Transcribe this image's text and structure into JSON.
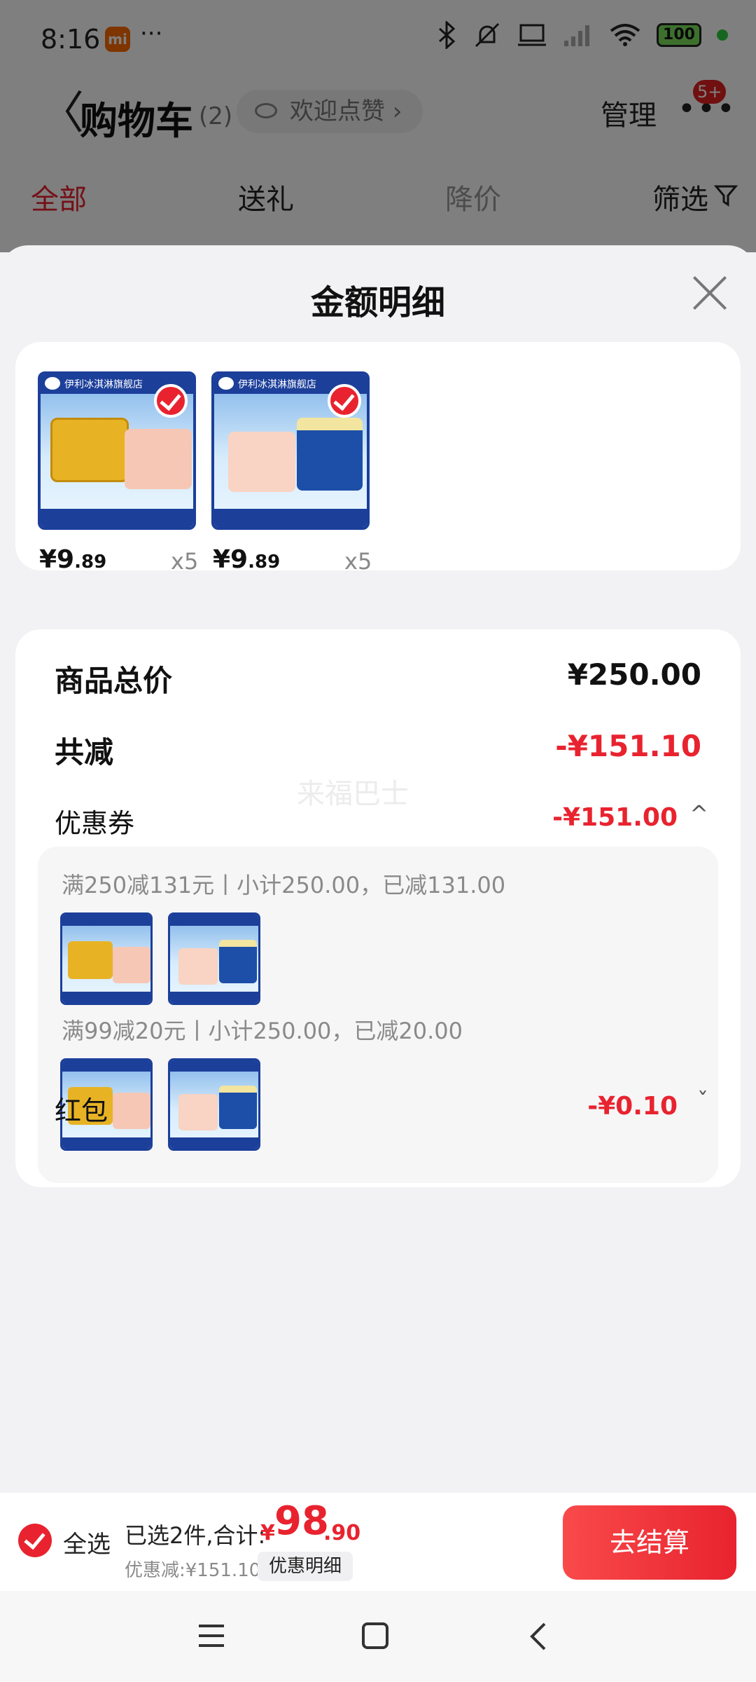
{
  "status_bar": {
    "time": "8:16",
    "mi_label": "mi",
    "dots": "···",
    "battery": "100"
  },
  "nav": {
    "back": "〈",
    "title": "购物车",
    "count": "(2)",
    "praise": "欢迎点赞",
    "praise_chevron": "›",
    "manage": "管理",
    "more": "•••",
    "badge": "5+"
  },
  "tabs": [
    {
      "label": "全部"
    },
    {
      "label": "送礼"
    },
    {
      "label": "降价"
    },
    {
      "label": "筛选"
    }
  ],
  "sheet": {
    "title": "金额明细",
    "products": [
      {
        "store": "伊利冰淇淋旗舰店",
        "price_int": "¥9",
        "price_dec": ".89",
        "qty": "x5"
      },
      {
        "store": "伊利冰淇淋旗舰店",
        "price_int": "¥9",
        "price_dec": ".89",
        "qty": "x5"
      }
    ],
    "total_label": "商品总价",
    "total_value": "¥250.00",
    "reduce_label": "共减",
    "reduce_value": "-¥151.10",
    "coupon_label": "优惠券",
    "coupon_value": "-¥151.00",
    "coupon_chevron": "^",
    "coupons": [
      {
        "text": "满250减131元丨小计250.00，已减131.00"
      },
      {
        "text": "满99减20元丨小计250.00，已减20.00"
      }
    ],
    "redpacket_label": "红包",
    "redpacket_value": "-¥0.10",
    "redpacket_chevron": "ˇ",
    "watermark": "来福巴士"
  },
  "bottom": {
    "select_all": "全选",
    "summary": "已选2件,合计:",
    "currency": "¥",
    "total_int": "98",
    "total_dec": ".90",
    "discount": "优惠减:¥151.10",
    "detail_btn": "优惠明细",
    "checkout": "去结算"
  },
  "colors": {
    "accent": "#e8232f",
    "text": "#111111",
    "muted": "#8a8a8a",
    "sheet_bg": "#f2f2f4"
  }
}
